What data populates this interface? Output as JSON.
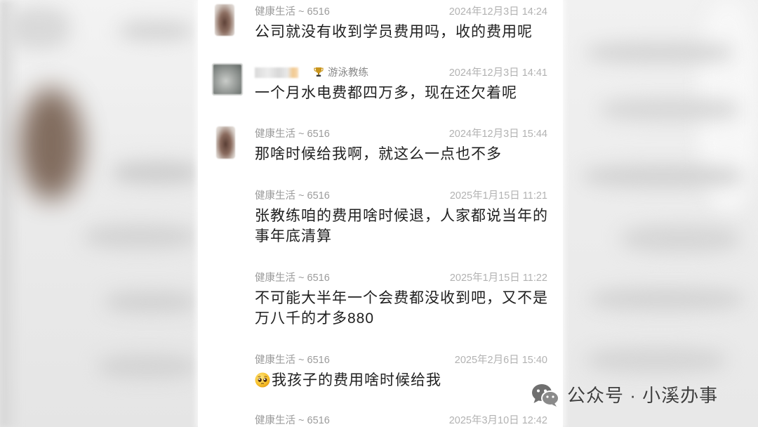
{
  "chat": {
    "messages": [
      {
        "sender": "健康生活 ~ 6516",
        "time": "2024年12月3日 14:24",
        "avatar": true,
        "lines": [
          "公司就没有收到学员费用吗，收的费用呢"
        ]
      },
      {
        "sender_obscured": true,
        "badge_icon": "trophy-icon",
        "badge": "游泳教练",
        "time": "2024年12月3日 14:41",
        "avatar": true,
        "lines": [
          "一个月水电费都四万多，现在还欠着呢"
        ]
      },
      {
        "sender": "健康生活 ~ 6516",
        "time": "2024年12月3日 15:44",
        "avatar": true,
        "lines": [
          "那啥时候给我啊，就这么一点也不多"
        ]
      },
      {
        "sender": "健康生活 ~ 6516",
        "time": "2025年1月15日 11:21",
        "avatar": false,
        "lines": [
          "张教练咱的费用啥时候退，人家都说当年的",
          "事年底清算"
        ]
      },
      {
        "sender": "健康生活 ~ 6516",
        "time": "2025年1月15日 11:22",
        "avatar": false,
        "lines": [
          "不可能大半年一个会费都没收到吧，又不是",
          "万八千的才多880"
        ]
      },
      {
        "sender": "健康生活 ~ 6516",
        "time": "2025年2月6日 15:40",
        "avatar": false,
        "emoji": "pleading-face-icon",
        "lines": [
          "我孩子的费用啥时候给我"
        ]
      },
      {
        "sender": "健康生活 ~ 6516",
        "time": "2025年3月10日 12:42",
        "avatar": false,
        "lines": []
      }
    ]
  },
  "watermark": {
    "icon": "wechat-icon",
    "text": "公众号 · 小溪办事"
  },
  "colors": {
    "panel": "#ffffff",
    "sender": "#9b9b9b",
    "time": "#b2b2b2",
    "text": "#1f1f1f",
    "badge_icon": "#c9951c",
    "watermark": "#3f3f3f"
  }
}
